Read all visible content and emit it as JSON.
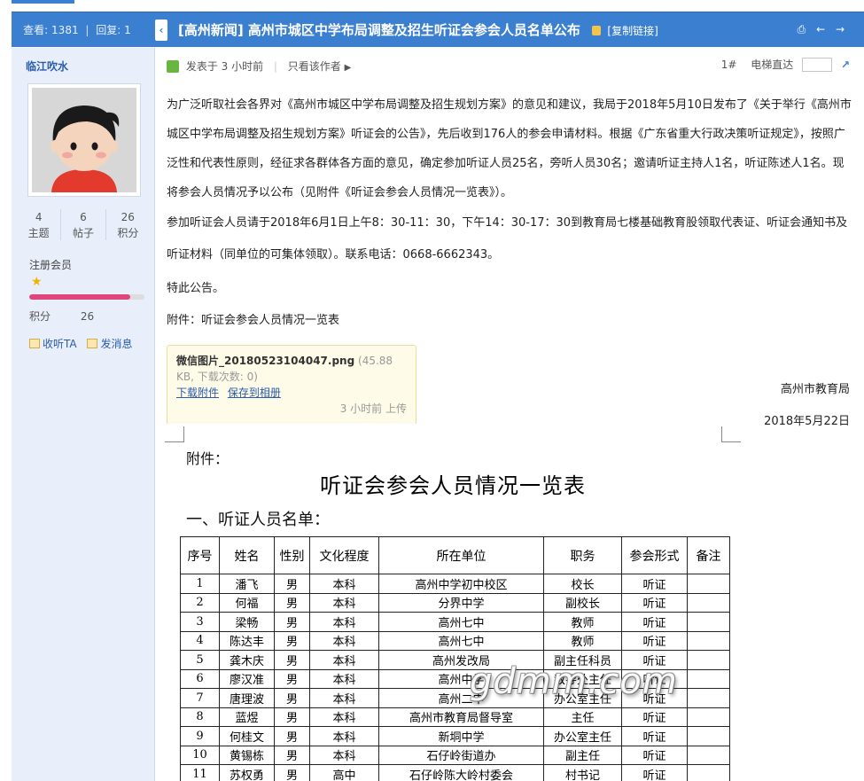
{
  "topbar": {
    "views_label": "查看:",
    "views": "1381",
    "replies_label": "回复:",
    "replies": "1",
    "collapse_glyph": "‹",
    "title": "[高州新闻] 高州市城区中学布局调整及招生听证会参会人员名单公布",
    "copy_link": "[复制链接]",
    "tools_glyphs": "⎙ ← →"
  },
  "author": {
    "name": "临江吹水",
    "stats": [
      {
        "num": "4",
        "label": "主题"
      },
      {
        "num": "6",
        "label": "帖子"
      },
      {
        "num": "26",
        "label": "积分"
      }
    ],
    "group": "注册会员",
    "star": "★",
    "level_progress": 0.88,
    "score_label": "积分",
    "score": "26",
    "follow": "收听TA",
    "message": "发消息"
  },
  "post": {
    "posted": "发表于 3 小时前",
    "only_author": "只看该作者",
    "only_author_arrow": "▶",
    "floor": "1#",
    "jump_label": "电梯直达",
    "jump_glyph": "↗",
    "paragraphs": [
      "为广泛听取社会各界对《高州市城区中学布局调整及招生规划方案》的意见和建议，我局于2018年5月10日发布了《关于举行《高州市城区中学布局调整及招生规划方案》听证会的公告》，先后收到176人的参会申请材料。根据《广东省重大行政决策听证规定》，按照广泛性和代表性原则，经征求各群体各方面的意见，确定参加听证人员25名，旁听人员30名；邀请听证主持人1名，听证陈述人1名。现将参会人员情况予以公布（见附件《听证会参会人员情况一览表》）。",
      "参加听证会人员请于2018年6月1日上午8：30-11：30，下午14：30-17：30到教育局七楼基础教育股领取代表证、听证会通知书及听证材料（同单位的可集体领取）。联系电话：0668-6662343。",
      "特此公告。",
      "附件：听证会参会人员情况一览表"
    ],
    "attachment": {
      "filename": "微信图片_20180523104047.png",
      "meta": "(45.88 KB, 下载次数: 0)",
      "download": "下载附件",
      "save": "保存到相册",
      "uploaded": "3 小时前 上传"
    },
    "signature": {
      "org": "高州市教育局",
      "date": "2018年5月22日"
    }
  },
  "doc": {
    "appendix_label": "附件：",
    "title": "听证会参会人员情况一览表",
    "section": "一、听证人员名单：",
    "columns": [
      "序号",
      "姓名",
      "性别",
      "文化程度",
      "所在单位",
      "职务",
      "参会形式",
      "备注"
    ],
    "rows": [
      [
        "1",
        "潘飞",
        "男",
        "本科",
        "高州中学初中校区",
        "校长",
        "听证",
        ""
      ],
      [
        "2",
        "何福",
        "男",
        "本科",
        "分界中学",
        "副校长",
        "听证",
        ""
      ],
      [
        "3",
        "梁畅",
        "男",
        "本科",
        "高州七中",
        "教师",
        "听证",
        ""
      ],
      [
        "4",
        "陈达丰",
        "男",
        "本科",
        "高州七中",
        "教师",
        "听证",
        ""
      ],
      [
        "5",
        "龚木庆",
        "男",
        "本科",
        "高州发改局",
        "副主任科员",
        "听证",
        ""
      ],
      [
        "6",
        "廖汉准",
        "男",
        "本科",
        "高州中学",
        "教导处主任",
        "听证",
        ""
      ],
      [
        "7",
        "唐理波",
        "男",
        "本科",
        "高州二中",
        "办公室主任",
        "听证",
        ""
      ],
      [
        "8",
        "蓝煜",
        "男",
        "本科",
        "高州市教育局督导室",
        "主任",
        "听证",
        ""
      ],
      [
        "9",
        "何桂文",
        "男",
        "本科",
        "新垌中学",
        "办公室主任",
        "听证",
        ""
      ],
      [
        "10",
        "黄锡栋",
        "男",
        "本科",
        "石仔岭街道办",
        "副主任",
        "听证",
        ""
      ],
      [
        "11",
        "苏权勇",
        "男",
        "高中",
        "石仔岭陈大岭村委会",
        "村书记",
        "听证",
        ""
      ]
    ],
    "watermark": "gdmm.com"
  }
}
